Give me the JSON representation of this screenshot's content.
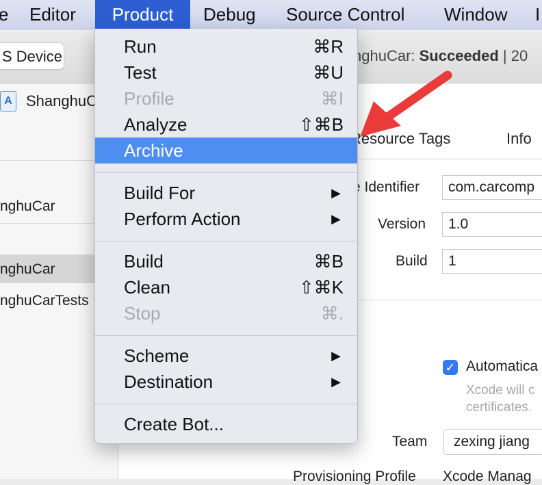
{
  "menubar": {
    "items": [
      "e",
      "Editor",
      "Product",
      "Debug",
      "Source Control",
      "Window",
      "I"
    ]
  },
  "toolbar": {
    "device_label": "S Device",
    "status_project": "nghuCar: ",
    "status_result": "Succeeded",
    "status_suffix": " | 20"
  },
  "navigator": {
    "project_name": "ShanghuC",
    "project_icon": "A",
    "target_label": "nghuCar",
    "targets": [
      "nghuCar",
      "nghuCarTests"
    ]
  },
  "editor": {
    "tabs": [
      "Resource Tags",
      "Info"
    ],
    "identity": {
      "bundle_identifier_label": "e Identifier",
      "bundle_identifier_value": "com.carcomp",
      "version_label": "Version",
      "version_value": "1.0",
      "build_label": "Build",
      "build_value": "1"
    },
    "signing": {
      "checkbox_label": "Automatica",
      "checkbox_mark": "✓",
      "hint_line1": "Xcode will c",
      "hint_line2": "certificates.",
      "team_label": "Team",
      "team_value": "zexing jiang",
      "profile_label": "Provisioning Profile",
      "profile_value": "Xcode Manag"
    }
  },
  "product_menu": {
    "run": {
      "label": "Run",
      "shortcut": "⌘R"
    },
    "test": {
      "label": "Test",
      "shortcut": "⌘U"
    },
    "profile": {
      "label": "Profile",
      "shortcut": "⌘I"
    },
    "analyze": {
      "label": "Analyze",
      "shortcut": "⇧⌘B"
    },
    "archive": {
      "label": "Archive"
    },
    "build_for": {
      "label": "Build For",
      "arrow": "▶"
    },
    "perform_action": {
      "label": "Perform Action",
      "arrow": "▶"
    },
    "build": {
      "label": "Build",
      "shortcut": "⌘B"
    },
    "clean": {
      "label": "Clean",
      "shortcut": "⇧⌘K"
    },
    "stop": {
      "label": "Stop",
      "shortcut": "⌘."
    },
    "scheme": {
      "label": "Scheme",
      "arrow": "▶"
    },
    "destination": {
      "label": "Destination",
      "arrow": "▶"
    },
    "create_bot": {
      "label": "Create Bot..."
    }
  },
  "colors": {
    "menu_highlight": "#4e8ef0",
    "menubar_active": "#2d5fd3",
    "annotation_arrow": "#ea3b3b",
    "checkbox": "#3478f6"
  }
}
